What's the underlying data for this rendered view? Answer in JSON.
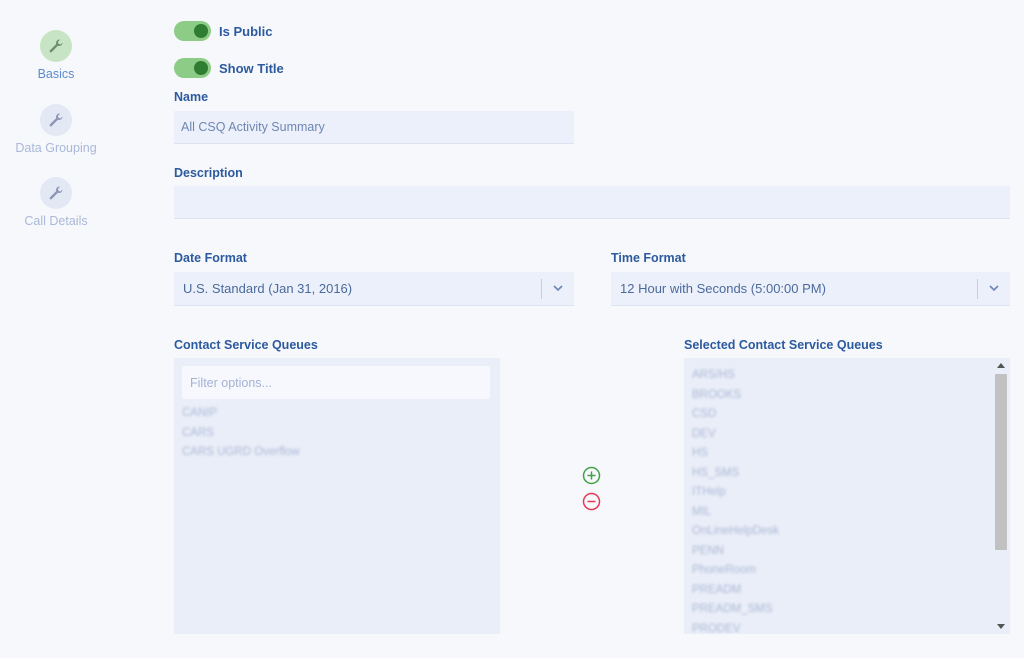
{
  "sidebar": {
    "steps": [
      {
        "label": "Basics",
        "icon": "wrench-icon",
        "active": true
      },
      {
        "label": "Data Grouping",
        "icon": "wrench-icon",
        "active": false
      },
      {
        "label": "Call Details",
        "icon": "wrench-icon",
        "active": false
      }
    ]
  },
  "toggles": {
    "is_public": {
      "label": "Is Public",
      "on": true
    },
    "show_title": {
      "label": "Show Title",
      "on": true
    }
  },
  "name": {
    "label": "Name",
    "value": "All CSQ Activity Summary"
  },
  "description": {
    "label": "Description",
    "value": ""
  },
  "date_format": {
    "label": "Date Format",
    "value": "U.S. Standard (Jan 31, 2016)"
  },
  "time_format": {
    "label": "Time Format",
    "value": "12 Hour with Seconds (5:00:00 PM)"
  },
  "available": {
    "label": "Contact Service Queues",
    "filter_placeholder": "Filter options...",
    "items": [
      "CANIP",
      "CARS",
      "CARS UGRD Overflow"
    ]
  },
  "selected": {
    "label": "Selected Contact Service Queues",
    "items": [
      "ARS/HS",
      "BROOKS",
      "CSD",
      "DEV",
      "HS",
      "HS_SMS",
      "ITHelp",
      "MIL",
      "OnLineHelpDesk",
      "PENN",
      "PhoneRoom",
      "PREADM",
      "PREADM_SMS",
      "PRODEV"
    ]
  },
  "colors": {
    "accent": "#2c5a9e",
    "toggle_on": "#2e7d32",
    "add": "#43a047",
    "remove": "#e53950"
  }
}
